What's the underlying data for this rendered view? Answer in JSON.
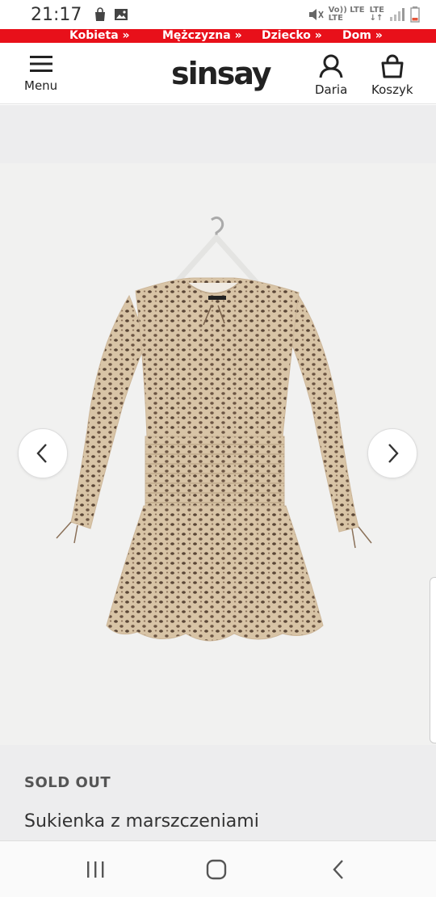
{
  "status_bar": {
    "time": "21:17",
    "network_top": "Vo)) LTE",
    "network_bottom": "LTE",
    "lte_label": "LTE"
  },
  "category_bar": {
    "items": [
      "Kobieta »",
      "Mężczyzna »",
      "Dziecko »",
      "Dom »"
    ],
    "color": "#e8101a"
  },
  "header": {
    "menu_label": "Menu",
    "logo": "sinsay",
    "account_label": "Daria",
    "cart_label": "Koszyk"
  },
  "product": {
    "status": "SOLD OUT",
    "name": "Sukienka z marszczeniami"
  },
  "icons": {
    "menu": "hamburger-icon",
    "account": "user-icon",
    "cart": "bag-icon",
    "prev": "chevron-left-icon",
    "next": "chevron-right-icon"
  }
}
